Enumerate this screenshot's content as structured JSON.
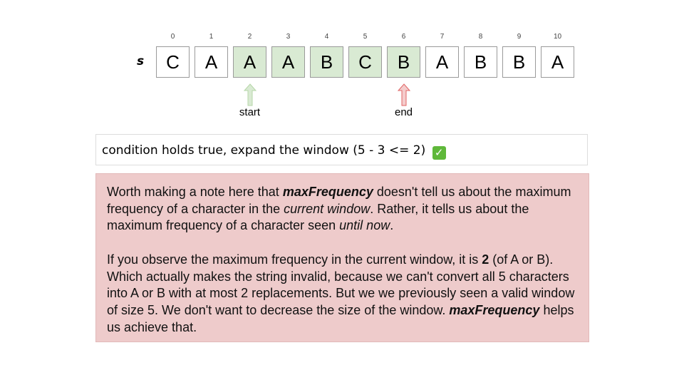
{
  "diagram": {
    "string_label": "s",
    "indices": [
      "0",
      "1",
      "2",
      "3",
      "4",
      "5",
      "6",
      "7",
      "8",
      "9",
      "10"
    ],
    "chars": [
      "C",
      "A",
      "A",
      "A",
      "B",
      "C",
      "B",
      "A",
      "B",
      "B",
      "A"
    ],
    "window_range": [
      2,
      6
    ],
    "highlight_color": "#d9ead3",
    "pointers": {
      "start": {
        "label": "start",
        "index": 2,
        "color": "#b6d7a8"
      },
      "end": {
        "label": "end",
        "index": 6,
        "color": "#ea9999"
      }
    }
  },
  "condition": {
    "text": "condition holds true, expand the window (5 - 3 <= 2)",
    "icon": "check-mark-button-icon",
    "icon_glyph": "✓"
  },
  "note": {
    "background": "#eecbcb",
    "p1": [
      "Worth making a note here that ",
      "maxFrequency",
      " doesn't tell us about the maximum frequency of a character in the ",
      "current window",
      ". Rather, it tells us about the maximum frequency of a character seen ",
      "until now",
      "."
    ],
    "p2": [
      "If you observe the maximum frequency in the current window, it is ",
      "2",
      " (of A or B). Which actually makes the string invalid, because we can't convert all 5 characters into A or B with at most 2 replacements. But we we previously seen a valid window of size 5. We don't want to decrease the size of the window. ",
      "maxFrequency",
      " helps us achieve that."
    ]
  }
}
